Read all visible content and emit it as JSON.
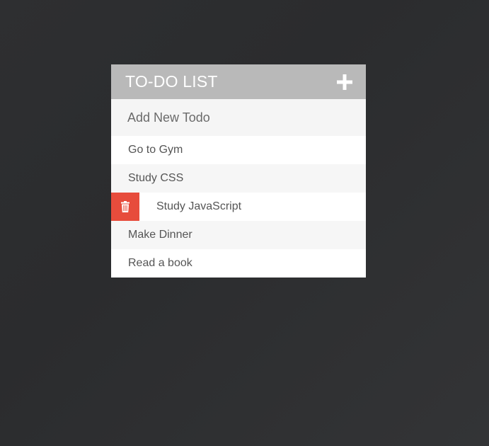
{
  "header": {
    "title": "TO-DO LIST",
    "add_icon": "plus-icon"
  },
  "new_todo": {
    "placeholder": "Add New Todo"
  },
  "todos": [
    {
      "text": "Go to Gym",
      "hovered": false
    },
    {
      "text": "Study CSS",
      "hovered": false
    },
    {
      "text": "Study JavaScript",
      "hovered": true
    },
    {
      "text": "Make Dinner",
      "hovered": false
    },
    {
      "text": "Read a book",
      "hovered": false
    }
  ],
  "delete_icon": "trash-icon",
  "colors": {
    "background": "#2d2e30",
    "header": "#b9b9b9",
    "delete": "#e74c3c",
    "text": "#555555"
  }
}
